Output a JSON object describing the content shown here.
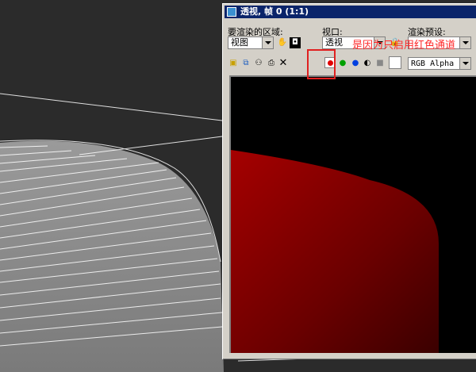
{
  "window": {
    "title": "透视, 帧 0 (1:1)"
  },
  "labels": {
    "region": "要渲染的区域:",
    "viewport": "视口:",
    "preset": "渲染预设:"
  },
  "dropdowns": {
    "region_value": "视图",
    "viewport_value": "透视",
    "channel_value": "RGB Alpha"
  },
  "annotation": {
    "text": "是因为只启用红色通道"
  },
  "colors": {
    "accent_red": "#e02020",
    "titlebar": "#0a246a",
    "render_fill": "#8c0000"
  },
  "icons": [
    "hand-icon",
    "camera-icon",
    "save-icon",
    "copy-icon",
    "clone-icon",
    "print-icon",
    "clear-icon",
    "red-channel-icon",
    "green-channel-icon",
    "blue-channel-icon",
    "alpha-icon",
    "mono-icon",
    "color-swatch-icon"
  ]
}
